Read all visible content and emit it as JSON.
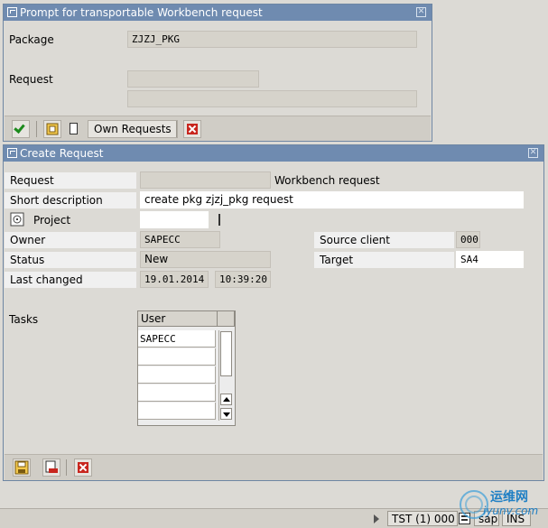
{
  "prompt_dialog": {
    "title": "Prompt for transportable Workbench request",
    "package_label": "Package",
    "package_value": "ZJZJ_PKG",
    "request_label": "Request",
    "request_value": "",
    "request_desc_value": "",
    "toolbar": {
      "own_requests_label": "Own Requests"
    }
  },
  "create_dialog": {
    "title": "Create Request",
    "request_label": "Request",
    "request_value": "",
    "request_type": "Workbench request",
    "short_desc_label": "Short description",
    "short_desc_value": "create pkg zjzj_pkg request",
    "project_label": "Project",
    "project_value": "",
    "owner_label": "Owner",
    "owner_value": "SAPECC",
    "source_client_label": "Source client",
    "source_client_value": "000",
    "status_label": "Status",
    "status_value": "New",
    "target_label": "Target",
    "target_value": "SA4",
    "last_changed_label": "Last changed",
    "last_changed_date": "19.01.2014",
    "last_changed_time": "10:39:20",
    "tasks_label": "Tasks",
    "tasks_table": {
      "column_header": "User",
      "rows": [
        "SAPECC",
        "",
        "",
        "",
        ""
      ]
    }
  },
  "statusbar": {
    "system": "TST (1) 000",
    "server": "sap",
    "mode": "INS"
  },
  "watermark": {
    "cn": "运维网",
    "url": "iyunv.com"
  },
  "colors": {
    "titlebar": "#6f8bb0",
    "window_bg": "#dcdad5",
    "confirm_green": "#1c8a1c",
    "cancel_red": "#c8261e"
  }
}
